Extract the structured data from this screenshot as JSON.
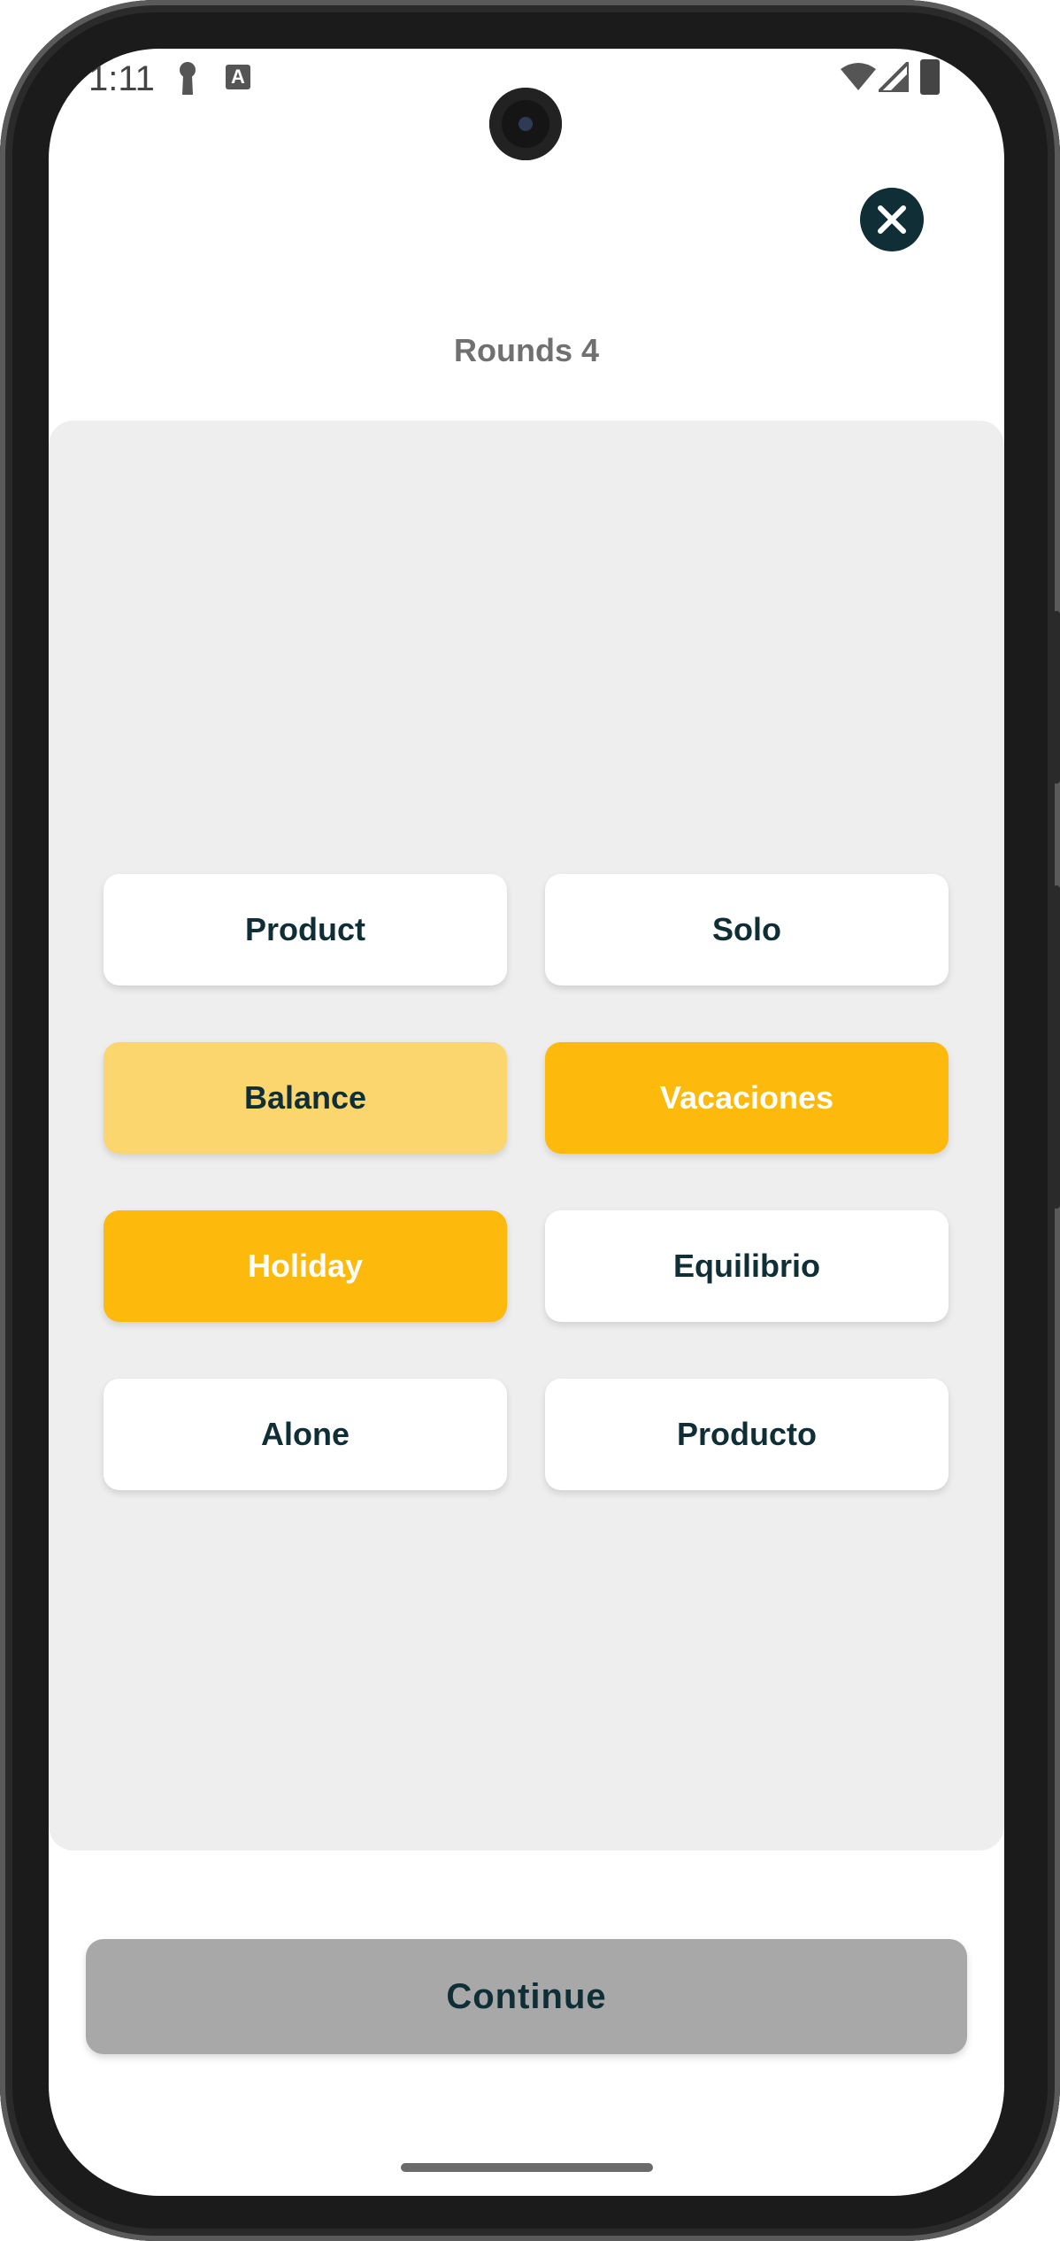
{
  "status_bar": {
    "time": "1:11"
  },
  "header": {
    "rounds_label": "Rounds 4"
  },
  "tiles": [
    {
      "label": "Product",
      "state": "default"
    },
    {
      "label": "Solo",
      "state": "default"
    },
    {
      "label": "Balance",
      "state": "selected-light"
    },
    {
      "label": "Vacaciones",
      "state": "selected"
    },
    {
      "label": "Holiday",
      "state": "selected"
    },
    {
      "label": "Equilibrio",
      "state": "default"
    },
    {
      "label": "Alone",
      "state": "default"
    },
    {
      "label": "Producto",
      "state": "default"
    }
  ],
  "footer": {
    "continue_label": "Continue"
  },
  "colors": {
    "accent": "#fdb90c",
    "accent_light": "#fbd56e",
    "dark": "#0f2e35",
    "panel": "#eeeeee",
    "disabled_button": "#a8a8a8"
  }
}
